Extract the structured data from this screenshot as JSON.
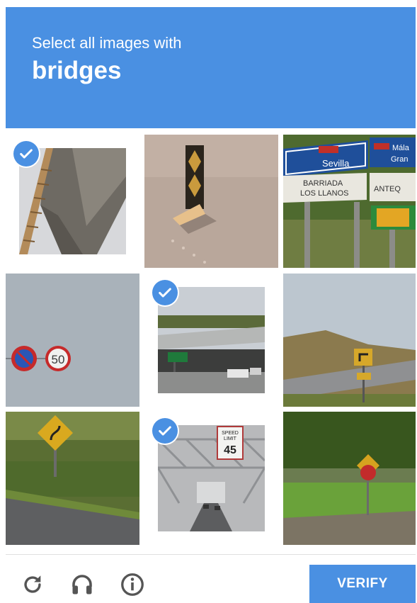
{
  "header": {
    "instruction": "Select all images with",
    "keyword": "bridges"
  },
  "tiles": [
    {
      "id": 1,
      "subject": "bridge underside with railing",
      "selected": true
    },
    {
      "id": 2,
      "subject": "chevron warning post on road",
      "selected": false
    },
    {
      "id": 3,
      "subject": "direction road signs",
      "selected": false
    },
    {
      "id": 4,
      "subject": "no parking and speed limit signs",
      "selected": false
    },
    {
      "id": 5,
      "subject": "highway overpass",
      "selected": true
    },
    {
      "id": 6,
      "subject": "hillside road with curve sign",
      "selected": false
    },
    {
      "id": 7,
      "subject": "yellow curve warning sign",
      "selected": false
    },
    {
      "id": 8,
      "subject": "steel truss bridge",
      "selected": true
    },
    {
      "id": 9,
      "subject": "stop sign in park",
      "selected": false
    }
  ],
  "signs": {
    "seville": "Sevilla",
    "barriada": "BARRIADA",
    "llanos": "LOS LLANOS",
    "mala": "Mála",
    "gran": "Gran",
    "ante": "ANTEQ",
    "speed": "50",
    "speed_limit": "SPEED",
    "limit": "LIMIT",
    "speed_val": "45"
  },
  "footer": {
    "verify_label": "VERIFY",
    "icons": [
      "reload-icon",
      "audio-icon",
      "info-icon"
    ]
  },
  "colors": {
    "accent": "#4a90e2"
  }
}
